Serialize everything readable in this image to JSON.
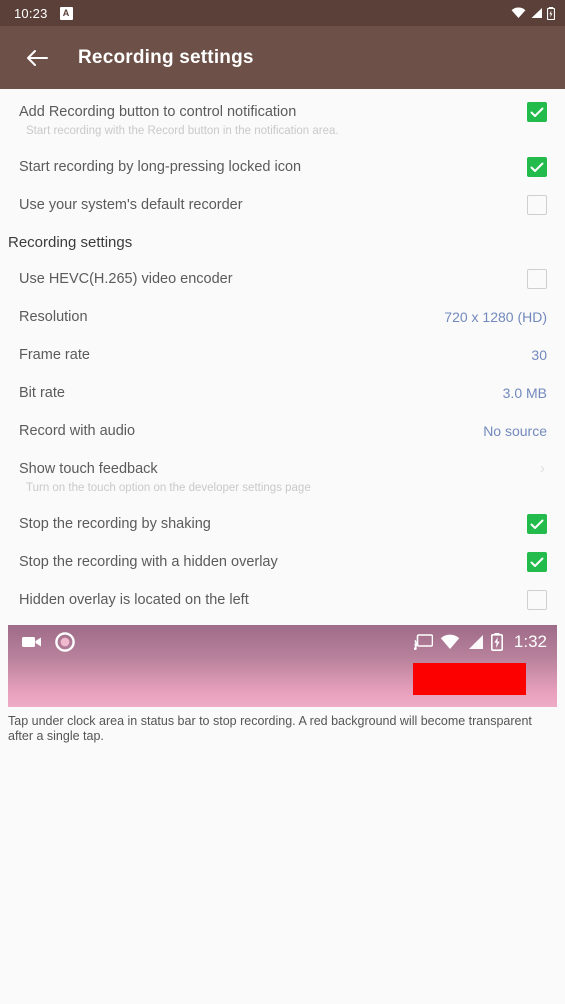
{
  "statusbar": {
    "clock": "10:23",
    "badge_label": "A",
    "icons": [
      "wifi-icon",
      "signal-icon",
      "battery-icon"
    ]
  },
  "appbar": {
    "back_icon": "back-arrow-icon",
    "title": "Recording settings"
  },
  "settings": {
    "top_items": [
      {
        "title": "Add Recording button to control notification",
        "subtitle": "Start recording with the Record button in the notification area.",
        "control": "checkbox",
        "checked": true
      },
      {
        "title": "Start recording by long-pressing locked icon",
        "subtitle": "",
        "control": "checkbox",
        "checked": true
      },
      {
        "title": "Use your system's default recorder",
        "subtitle": "",
        "control": "checkbox",
        "checked": false
      }
    ],
    "section_title": "Recording settings",
    "section_items": [
      {
        "title": "Use HEVC(H.265) video encoder",
        "subtitle": "",
        "control": "checkbox",
        "checked": false,
        "value": ""
      },
      {
        "title": "Resolution",
        "subtitle": "",
        "control": "value",
        "checked": false,
        "value": "720 x 1280 (HD)"
      },
      {
        "title": "Frame rate",
        "subtitle": "",
        "control": "value",
        "checked": false,
        "value": "30"
      },
      {
        "title": "Bit rate",
        "subtitle": "",
        "control": "value",
        "checked": false,
        "value": "3.0 MB"
      },
      {
        "title": "Record with audio",
        "subtitle": "",
        "control": "value",
        "checked": false,
        "value": "No source"
      },
      {
        "title": "Show touch feedback",
        "subtitle": "Turn on the touch option on the developer settings page",
        "control": "chevron",
        "checked": false,
        "value": "›"
      },
      {
        "title": "Stop the recording by shaking",
        "subtitle": "",
        "control": "checkbox",
        "checked": true,
        "value": ""
      },
      {
        "title": "Stop the recording with a hidden overlay",
        "subtitle": "",
        "control": "checkbox",
        "checked": true,
        "value": ""
      },
      {
        "title": "Hidden overlay is located on the left",
        "subtitle": "",
        "control": "checkbox",
        "checked": false,
        "value": ""
      }
    ]
  },
  "preview": {
    "left_icons": [
      "videocam-icon",
      "record-circle-icon"
    ],
    "right_icons": [
      "cast-icon",
      "wifi-icon",
      "signal-icon",
      "battery-charging-icon"
    ],
    "clock": "1:32",
    "highlight_color": "#fc0000"
  },
  "caption": "Tap under clock area in status bar to stop recording. A red background will become transparent after a single tap.",
  "colors": {
    "statusbar_bg": "#5a4038",
    "appbar_bg": "#6d5048",
    "page_bg": "#fafafa",
    "checkbox_on": "#22bb4c",
    "value_blue": "#7289bd"
  }
}
